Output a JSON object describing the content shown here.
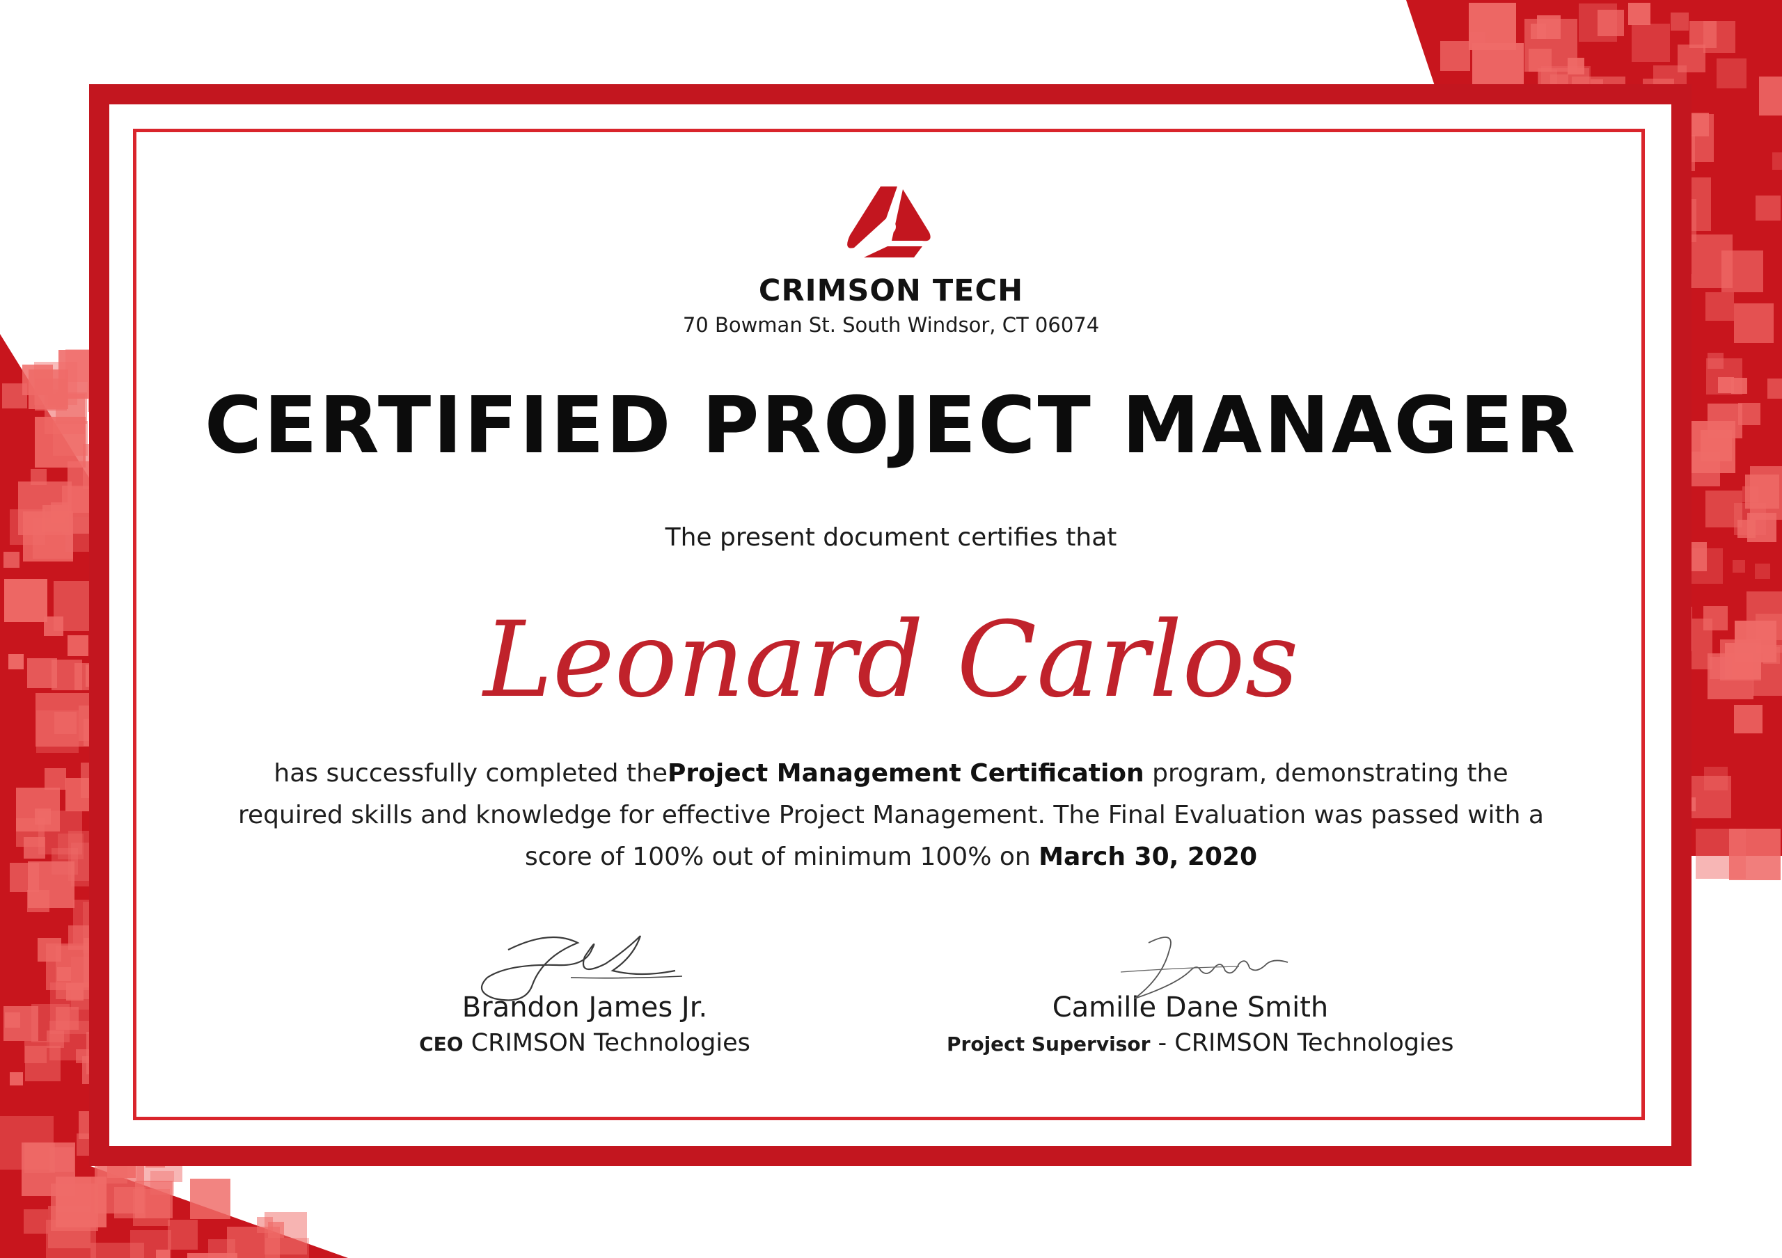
{
  "company": {
    "name": "CRIMSON TECH",
    "address": "70 Bowman St. South Windsor, CT 06074",
    "logo_icon": "crimson-triangle-logo-icon"
  },
  "certificate": {
    "title": "CERTIFIED PROJECT MANAGER",
    "intro": "The present document certifies that",
    "recipient": "Leonard Carlos",
    "body_part1": "has successfully completed the",
    "program": "Project Management Certification",
    "body_part2": " program, demonstrating the required skills and knowledge for effective Project Management. The Final Evaluation was passed with a score of 100% out of minimum 100% on ",
    "date": "March 30, 2020"
  },
  "signatures": [
    {
      "name": "Brandon James Jr.",
      "role": "CEO",
      "org": " CRIMSON Technologies"
    },
    {
      "name": "Camille Dane Smith",
      "role": "Project Supervisor",
      "org": " - CRIMSON Technologies"
    }
  ],
  "colors": {
    "frame": "#c3161f",
    "inner_line": "#d9252c",
    "recipient_text": "#c0222b",
    "mosaic_dark": "#c8151d",
    "mosaic_light": "#ef6b68"
  }
}
